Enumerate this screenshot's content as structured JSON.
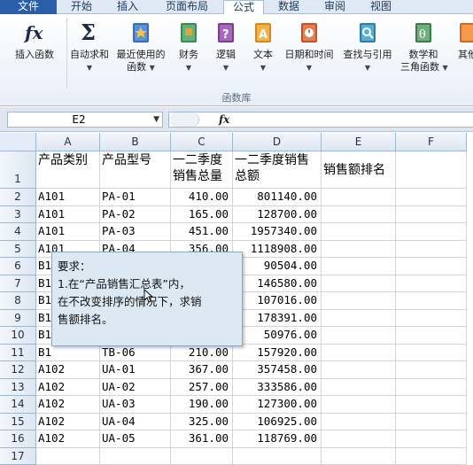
{
  "ribbon": {
    "tabs": [
      "文件",
      "开始",
      "插入",
      "页面布局",
      "公式",
      "数据",
      "审阅",
      "视图"
    ],
    "active_tab": "公式",
    "buttons": [
      {
        "label": "插入函数",
        "icon": "fx-icon"
      },
      {
        "label": "自动求和",
        "icon": "sigma-icon"
      },
      {
        "label": "最近使用的\n函数",
        "icon": "recent-book-icon"
      },
      {
        "label": "财务",
        "icon": "finance-book-icon"
      },
      {
        "label": "逻辑",
        "icon": "logic-book-icon"
      },
      {
        "label": "文本",
        "icon": "text-book-icon"
      },
      {
        "label": "日期和时间",
        "icon": "date-book-icon"
      },
      {
        "label": "查找与引用",
        "icon": "lookup-book-icon"
      },
      {
        "label": "数学和\n三角函数",
        "icon": "math-book-icon"
      },
      {
        "label": "其他",
        "icon": "more-book-icon"
      }
    ],
    "group_label": "函数库"
  },
  "formula_bar": {
    "name_box": "E2",
    "fx": "fx",
    "content": ""
  },
  "sheet": {
    "columns": [
      "A",
      "B",
      "C",
      "D",
      "E",
      "F"
    ],
    "header_row": {
      "row": "1",
      "a": "产品类别",
      "b": "产品型号",
      "c": "一二季度销售总量",
      "d": "一二季度销售总额",
      "e": "销售额排名",
      "f": ""
    },
    "rows": [
      {
        "row": "2",
        "a": "A101",
        "b": "PA-01",
        "c": "410.00",
        "d": "801140.00"
      },
      {
        "row": "3",
        "a": "A101",
        "b": "PA-02",
        "c": "165.00",
        "d": "128700.00"
      },
      {
        "row": "4",
        "a": "A101",
        "b": "PA-03",
        "c": "451.00",
        "d": "1957340.00"
      },
      {
        "row": "5",
        "a": "A101",
        "b": "PA-04",
        "c": "356.00",
        "d": "1118908.00"
      },
      {
        "row": "6",
        "a": "B1",
        "b": "",
        "c": "",
        "d": "90504.00"
      },
      {
        "row": "7",
        "a": "B1",
        "b": "",
        "c": "",
        "d": "146580.00"
      },
      {
        "row": "8",
        "a": "B1",
        "b": "",
        "c": "",
        "d": "107016.00"
      },
      {
        "row": "9",
        "a": "B1",
        "b": "",
        "c": "",
        "d": "178391.00"
      },
      {
        "row": "10",
        "a": "B1",
        "b": "",
        "c": "",
        "d": "50976.00"
      },
      {
        "row": "11",
        "a": "B1",
        "b": "TB-06",
        "c": "210.00",
        "d": "157920.00"
      },
      {
        "row": "12",
        "a": "A102",
        "b": "UA-01",
        "c": "367.00",
        "d": "357458.00"
      },
      {
        "row": "13",
        "a": "A102",
        "b": "UA-02",
        "c": "257.00",
        "d": "333586.00"
      },
      {
        "row": "14",
        "a": "A102",
        "b": "UA-03",
        "c": "190.00",
        "d": "127300.00"
      },
      {
        "row": "15",
        "a": "A102",
        "b": "UA-04",
        "c": "325.00",
        "d": "106925.00"
      },
      {
        "row": "16",
        "a": "A102",
        "b": "UA-05",
        "c": "361.00",
        "d": "118769.00"
      },
      {
        "row": "17",
        "a": "",
        "b": "",
        "c": "",
        "d": ""
      }
    ]
  },
  "comment": {
    "line1": "要求：",
    "line2": "1.在“产品销售汇总表”内，",
    "line3": "在不改变排序的情况下，求销",
    "line4": "售额排名。"
  },
  "colors": {
    "file_tab": "#2a5ea8",
    "ribbon_bg": "#e7eef8",
    "header_bg": "#dde6f1",
    "comment_bg": "#dce9f3"
  }
}
